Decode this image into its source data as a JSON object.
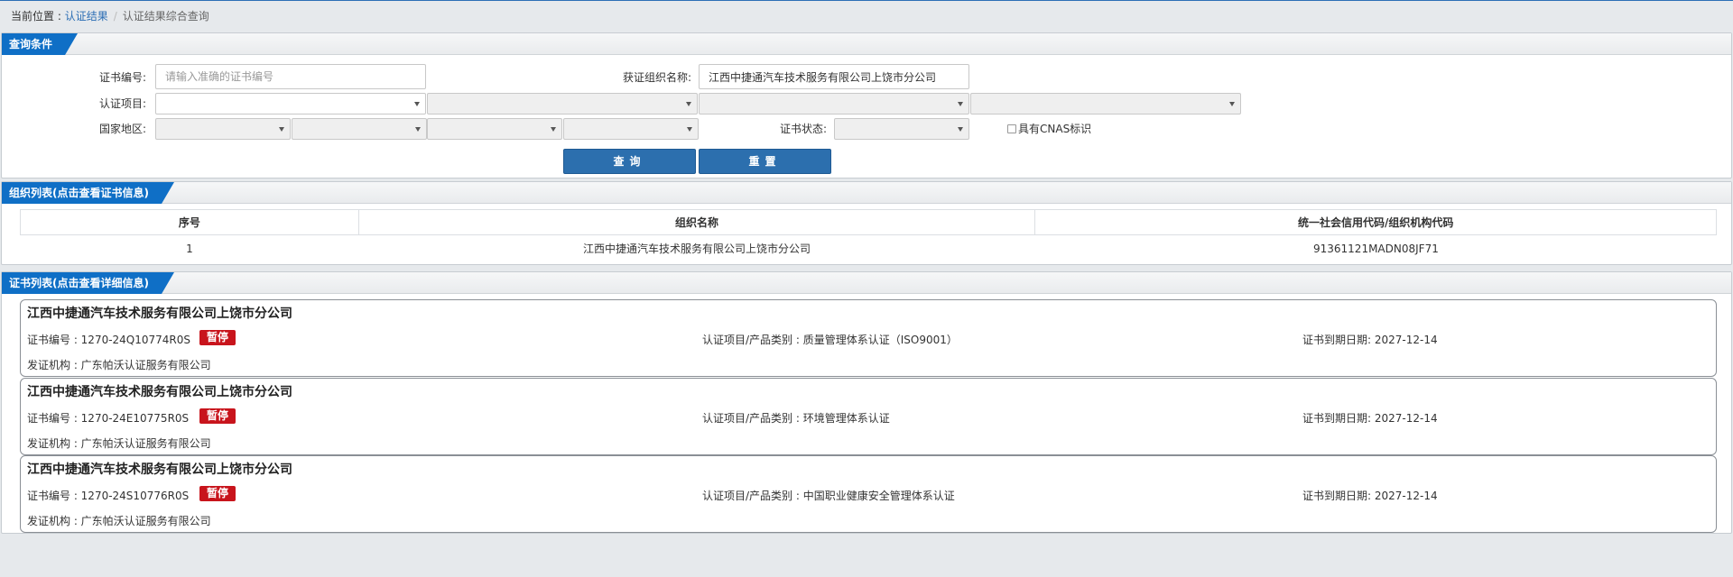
{
  "breadcrumb": {
    "prefix": "当前位置 : ",
    "link": "认证结果",
    "separator": "/",
    "current": "认证结果综合查询"
  },
  "query": {
    "title": "查询条件",
    "cert_no_label": "证书编号:",
    "cert_no_placeholder": "请输入准确的证书编号",
    "org_name_label": "获证组织名称:",
    "org_name_value": "江西中捷通汽车技术服务有限公司上饶市分公司",
    "project_label": "认证项目:",
    "region_label": "国家地区:",
    "status_label": "证书状态:",
    "cnas_label": "具有CNAS标识",
    "search_button": "查询",
    "reset_button": "重置"
  },
  "org_list": {
    "title": "组织列表(点击查看证书信息)",
    "columns": [
      "序号",
      "组织名称",
      "统一社会信用代码/组织机构代码"
    ],
    "rows": [
      [
        "1",
        "江西中捷通汽车技术服务有限公司上饶市分公司",
        "91361121MADN08JF71"
      ]
    ]
  },
  "cert_list": {
    "title": "证书列表(点击查看详细信息)",
    "items": [
      {
        "org": "江西中捷通汽车技术服务有限公司上饶市分公司",
        "cert_no": "证书编号 : 1270-24Q10774R0S",
        "status": "暂停",
        "category": "认证项目/产品类别 : 质量管理体系认证（ISO9001）",
        "expiry": "证书到期日期: 2027-12-14",
        "issuer": "发证机构 : 广东帕沃认证服务有限公司"
      },
      {
        "org": "江西中捷通汽车技术服务有限公司上饶市分公司",
        "cert_no": "证书编号 : 1270-24E10775R0S",
        "status": "暂停",
        "category": "认证项目/产品类别 : 环境管理体系认证",
        "expiry": "证书到期日期: 2027-12-14",
        "issuer": "发证机构 : 广东帕沃认证服务有限公司"
      },
      {
        "org": "江西中捷通汽车技术服务有限公司上饶市分公司",
        "cert_no": "证书编号 : 1270-24S10776R0S",
        "status": "暂停",
        "category": "认证项目/产品类别 : 中国职业健康安全管理体系认证",
        "expiry": "证书到期日期: 2027-12-14",
        "issuer": "发证机构 : 广东帕沃认证服务有限公司"
      }
    ]
  },
  "colors": {
    "accent": "#0f6fc6",
    "button": "#2c6fae",
    "badge": "#c8141c"
  }
}
